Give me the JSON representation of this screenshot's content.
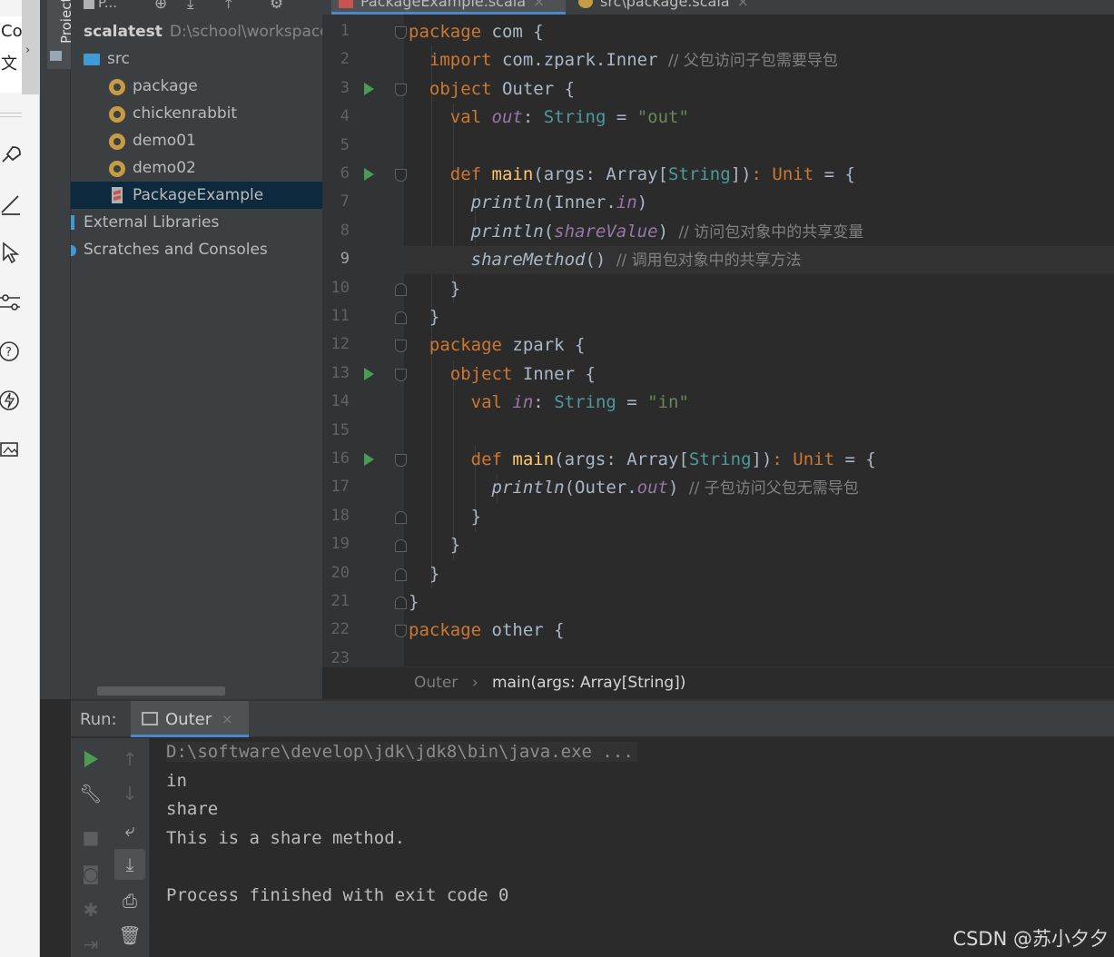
{
  "left_strip": {
    "top_text_1": "Co",
    "top_text_2": "文"
  },
  "tool_stripe": {
    "project_tab_label": "Project"
  },
  "project_pane": {
    "toolbar_label": "P...",
    "tree": [
      {
        "label": "scalatest",
        "path": "D:\\school\\workspace",
        "icon": "module-folder-icon"
      },
      {
        "label": "src",
        "icon": "source-folder-icon"
      },
      {
        "label": "package",
        "icon": "package-object-icon"
      },
      {
        "label": "chickenrabbit",
        "icon": "package-icon"
      },
      {
        "label": "demo01",
        "icon": "package-icon"
      },
      {
        "label": "demo02",
        "icon": "package-icon"
      },
      {
        "label": "PackageExample",
        "icon": "scala-file-icon",
        "selected": true
      },
      {
        "label": "External Libraries",
        "icon": "libraries-icon"
      },
      {
        "label": "Scratches and Consoles",
        "icon": "scratches-icon"
      }
    ]
  },
  "editor": {
    "tabs": [
      {
        "label": "PackageExample.scala",
        "active": true
      },
      {
        "label": "src\\package.scala",
        "active": false
      }
    ],
    "current_line": 9,
    "breadcrumb": [
      "Outer",
      "main(args: Array[String])"
    ]
  },
  "run_panel": {
    "label": "Run:",
    "tab_title": "Outer",
    "console_lines": [
      "D:\\software\\develop\\jdk\\jdk8\\bin\\java.exe ...",
      "in",
      "share",
      "This is a share method.",
      "",
      "Process finished with exit code 0"
    ]
  },
  "watermark": "CSDN @苏小夕夕",
  "colors": {
    "keyword": "#cc7832",
    "function": "#ffc66d",
    "type": "#4e9a9b",
    "string": "#6a8759",
    "field": "#9876aa",
    "comment": "#808080",
    "selection": "#0d293e",
    "run_green": "#499c54"
  }
}
